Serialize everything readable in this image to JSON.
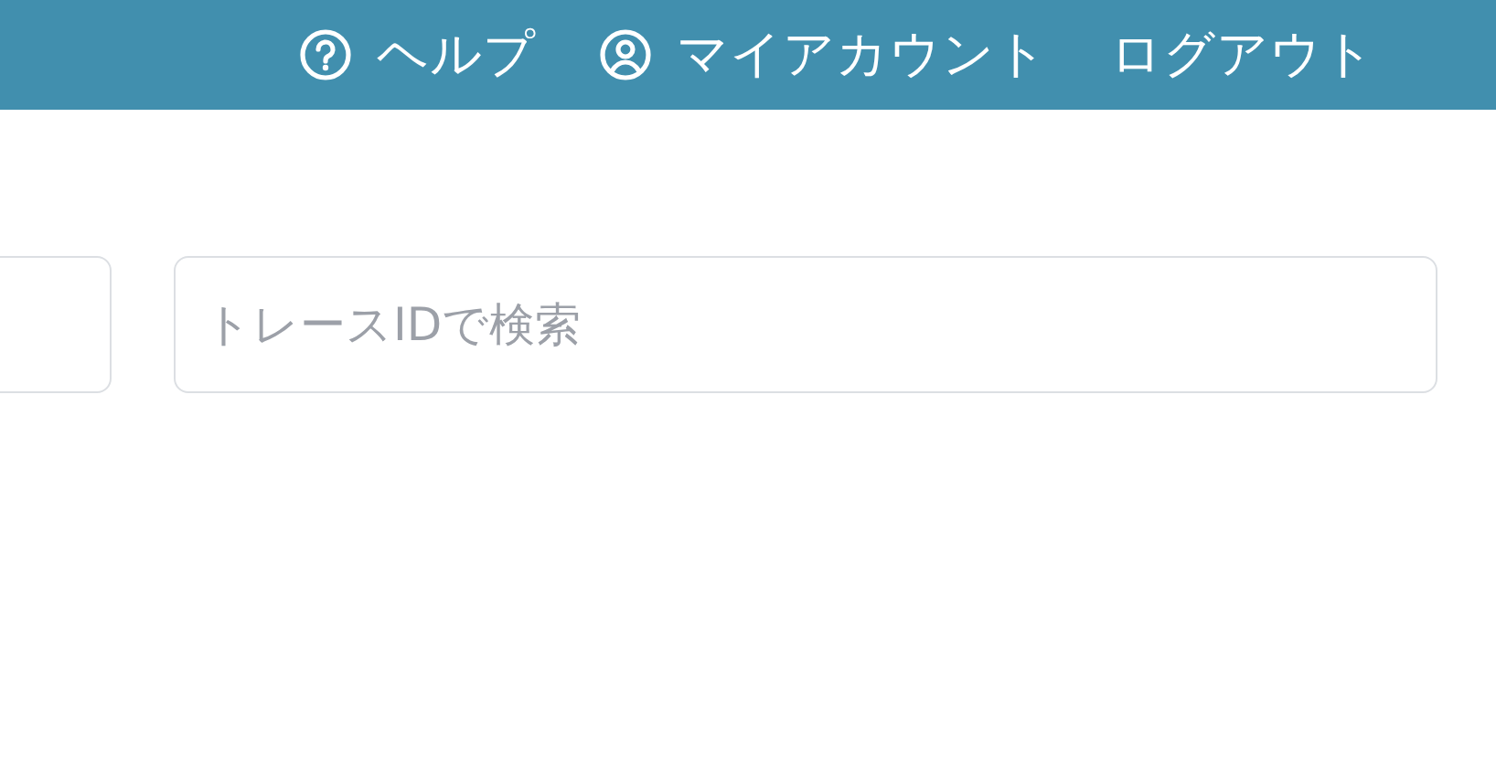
{
  "header": {
    "links": [
      {
        "kind": "help",
        "label": "ヘルプ"
      },
      {
        "kind": "account",
        "label": "マイアカウント"
      },
      {
        "kind": "plain",
        "label": "ログアウト"
      }
    ]
  },
  "filters": [
    {
      "kind": "blank"
    },
    {
      "kind": "search",
      "placeholder": "トレースIDで検索"
    }
  ]
}
